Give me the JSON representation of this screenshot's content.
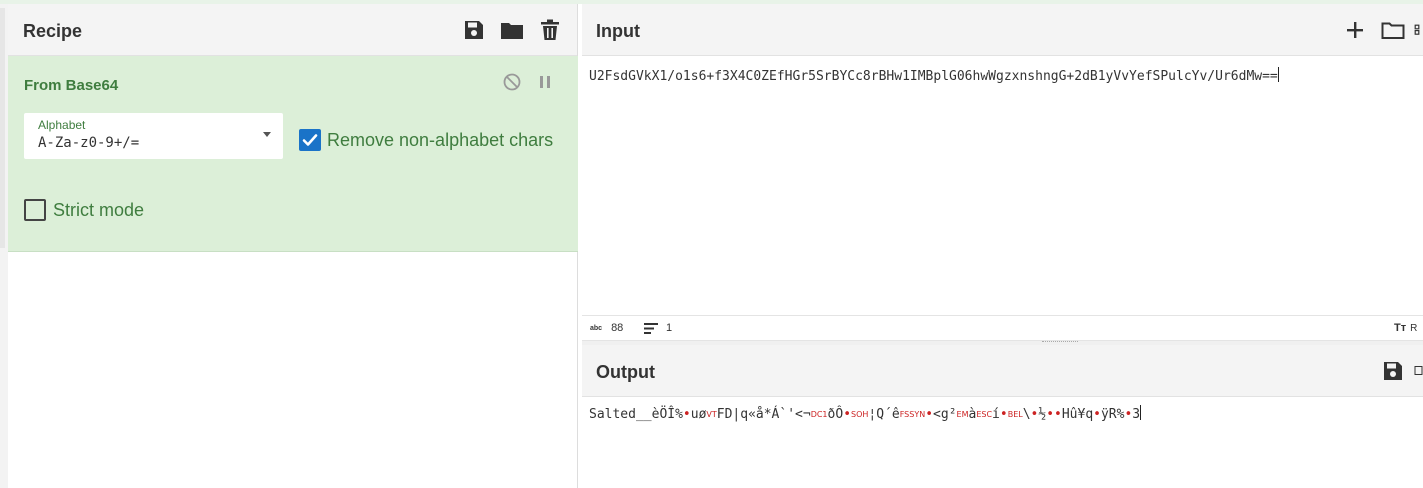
{
  "recipe": {
    "title": "Recipe",
    "icons": [
      "save-icon",
      "folder-icon",
      "trash-icon"
    ],
    "operation": {
      "name": "From Base64",
      "alphabet_label": "Alphabet",
      "alphabet_value": "A-Za-z0-9+/=",
      "remove_non_alphabet_label": "Remove non-alphabet chars",
      "remove_non_alphabet_checked": true,
      "strict_mode_label": "Strict mode",
      "strict_mode_checked": false
    }
  },
  "input": {
    "title": "Input",
    "text": "U2FsdGVkX1/o1s6+f3X4C0ZEfHGr5SrBYCc8rBHw1IMBplG06hwWgzxnshngG+2dB1yVvYefSPulcYv/Ur6dMw==",
    "char_count": "88",
    "line_count": "1",
    "char_count_icon": "abc",
    "font_icon_label": "Tт",
    "font_icon_trailing": "R"
  },
  "output": {
    "title": "Output",
    "seg1": "Salted__èÖÎ%",
    "seg2": "uø",
    "ctl_vt": "VT",
    "seg3": "FD|q«å*Á`'<¬",
    "ctl_dc1": "DC1",
    "seg4": "ðÔ",
    "ctl_soh": "SOH",
    "seg5": "¦Q´ê",
    "ctl_fs": "FS",
    "ctl_syn": "SYN",
    "seg6": "<g²",
    "ctl_em": "EM",
    "seg7": "à",
    "ctl_esc": "ESC",
    "seg8": "í",
    "ctl_bel": "BEL",
    "seg9": "\\",
    "seg10": "½",
    "seg11": "Hû¥q",
    "seg12": "ÿR%",
    "seg13": "3"
  },
  "colors": {
    "accent_green": "#3f7d3f",
    "op_background": "#dcefd8",
    "checkbox_blue": "#1a73c8",
    "control_red": "#cc2222"
  }
}
